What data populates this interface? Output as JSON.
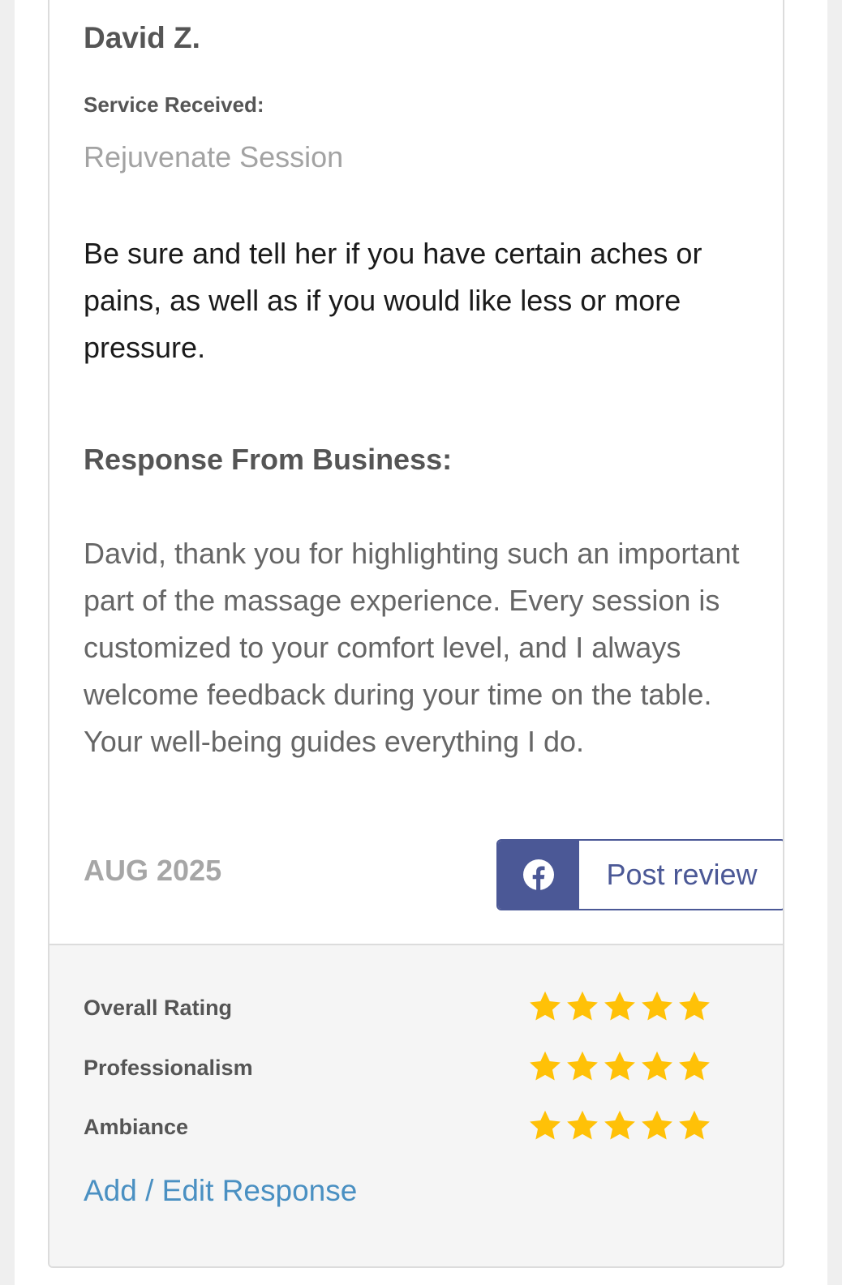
{
  "review": {
    "reviewer_name": "David Z.",
    "service_label": "Service Received:",
    "service_value": "Rejuvenate Session",
    "text": "Be sure and tell her if you have certain aches or pains, as well as if you would like less or more pressure.",
    "response_heading": "Response From Business:",
    "response_text": "David, thank you for highlighting such an important part of the massage experience. Every session is customized to your comfort level, and I always welcome feedback during your time on the table. Your well-being guides everything I do.",
    "date": "AUG 2025",
    "post_button": {
      "label": "Post review",
      "icon": "facebook-icon",
      "color": "#4b5896"
    }
  },
  "ratings": {
    "items": [
      {
        "label": "Overall Rating",
        "stars": 5,
        "max": 5
      },
      {
        "label": "Professionalism",
        "stars": 5,
        "max": 5
      },
      {
        "label": "Ambiance",
        "stars": 5,
        "max": 5
      }
    ],
    "star_color": "#ffc107",
    "edit_link": "Add / Edit Response",
    "link_color": "#4a90c2"
  }
}
